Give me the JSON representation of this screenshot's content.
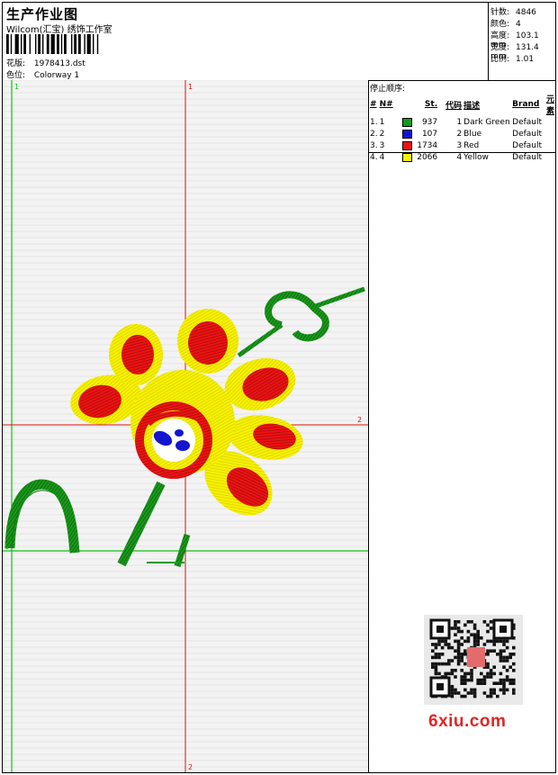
{
  "header": {
    "title": "生产作业图",
    "studio": "Wilcom(汇宝) 绣饰工作室",
    "design_label": "花版:",
    "design_value": "1978413.dst",
    "colorway_label": "色位:",
    "colorway_value": "Colorway 1"
  },
  "stats": [
    {
      "label": "针数:",
      "value": "4846"
    },
    {
      "label": "颜色:",
      "value": "4"
    },
    {
      "label": "高度:",
      "value": "103.1 mm"
    },
    {
      "label": "宽度:",
      "value": "131.4 mm"
    },
    {
      "label": "比例:",
      "value": "1.01"
    }
  ],
  "sequence": {
    "title": "停止顺序:",
    "headers": [
      "#",
      "N#",
      "St.",
      "代码",
      "描述",
      "Brand",
      "元素"
    ],
    "rows": [
      {
        "idx": "1.",
        "n": "1",
        "color": "#119c1c",
        "stitches": "937",
        "code": "1",
        "desc": "Dark Green",
        "brand": "Default"
      },
      {
        "idx": "2.",
        "n": "2",
        "color": "#1010d8",
        "stitches": "107",
        "code": "2",
        "desc": "Blue",
        "brand": "Default"
      },
      {
        "idx": "3.",
        "n": "3",
        "color": "#ee1111",
        "stitches": "1734",
        "code": "3",
        "desc": "Red",
        "brand": "Default"
      },
      {
        "idx": "4.",
        "n": "4",
        "color": "#f5f500",
        "stitches": "2066",
        "code": "4",
        "desc": "Yellow",
        "brand": "Default"
      }
    ]
  },
  "guides": {
    "v_red_top": "1",
    "v_red_bottom": "2",
    "h_red_right": "2",
    "v_green_top": "1",
    "h_green_left": "1"
  },
  "watermark": {
    "site": "6xiu.com",
    "seal": "汇宝"
  }
}
